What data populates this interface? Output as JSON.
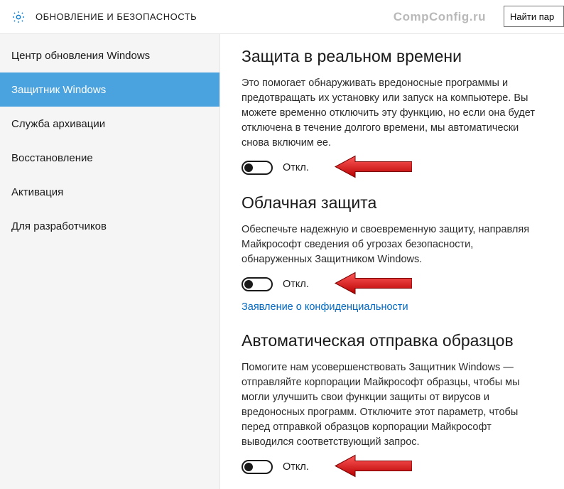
{
  "header": {
    "title": "ОБНОВЛЕНИЕ И БЕЗОПАСНОСТЬ",
    "watermark": "CompConfig.ru",
    "search_placeholder": "Найти пар"
  },
  "sidebar": {
    "items": [
      {
        "label": "Центр обновления Windows",
        "active": false
      },
      {
        "label": "Защитник Windows",
        "active": true
      },
      {
        "label": "Служба архивации",
        "active": false
      },
      {
        "label": "Восстановление",
        "active": false
      },
      {
        "label": "Активация",
        "active": false
      },
      {
        "label": "Для разработчиков",
        "active": false
      }
    ]
  },
  "sections": {
    "realtime": {
      "title": "Защита в реальном времени",
      "desc": "Это помогает обнаруживать вредоносные программы и предотвращать их установку или запуск на компьютере. Вы можете временно отключить эту функцию, но если она будет отключена в течение долгого времени, мы автоматически снова включим ее.",
      "toggle_label": "Откл."
    },
    "cloud": {
      "title": "Облачная защита",
      "desc": "Обеспечьте надежную и своевременную защиту, направляя Майкрософт сведения об угрозах безопасности, обнаруженных Защитником Windows.",
      "toggle_label": "Откл.",
      "link": "Заявление о конфиденциальности"
    },
    "samples": {
      "title": "Автоматическая отправка образцов",
      "desc": "Помогите нам усовершенствовать Защитник Windows — отправляйте корпорации Майкрософт образцы, чтобы мы могли улучшить свои функции защиты от вирусов и вредоносных программ. Отключите этот параметр, чтобы перед отправкой образцов корпорации Майкрософт выводился соответствующий запрос.",
      "toggle_label": "Откл."
    }
  }
}
